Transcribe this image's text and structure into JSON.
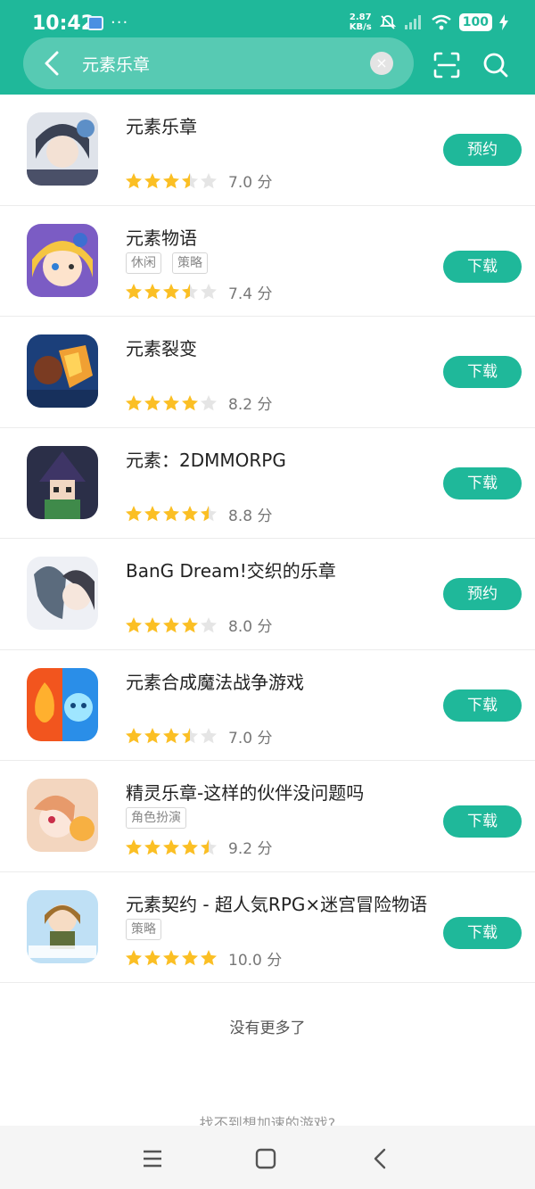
{
  "status": {
    "time": "10:42",
    "dots": "···",
    "net_speed_value": "2.87",
    "net_speed_unit": "KB/s",
    "battery": "100"
  },
  "search": {
    "query": "元素乐章",
    "clear_glyph": "×"
  },
  "results": [
    {
      "name": "元素乐章",
      "tags": [],
      "rating": 3.5,
      "score": "7.0 分",
      "action": "预约",
      "icon": "elemental-chapter-icon"
    },
    {
      "name": "元素物语",
      "tags": [
        "休闲",
        "策略"
      ],
      "rating": 3.5,
      "score": "7.4 分",
      "action": "下载",
      "icon": "elemental-story-icon"
    },
    {
      "name": "元素裂变",
      "tags": [],
      "rating": 4,
      "score": "8.2 分",
      "action": "下载",
      "icon": "elemental-fission-icon"
    },
    {
      "name": "元素：2DMMORPG",
      "tags": [],
      "rating": 4.5,
      "score": "8.8 分",
      "action": "下载",
      "icon": "elemental-mmorpg-icon"
    },
    {
      "name": "BanG Dream!交织的乐章",
      "tags": [],
      "rating": 4,
      "score": "8.0 分",
      "action": "预约",
      "icon": "bang-dream-icon"
    },
    {
      "name": "元素合成魔法战争游戏",
      "tags": [],
      "rating": 3.5,
      "score": "7.0 分",
      "action": "下载",
      "icon": "element-merge-icon"
    },
    {
      "name": "精灵乐章-这样的伙伴没问题吗",
      "tags": [
        "角色扮演"
      ],
      "rating": 4.5,
      "score": "9.2 分",
      "action": "下载",
      "icon": "spirit-chapter-icon"
    },
    {
      "name": "元素契约 - 超人気RPG×迷宫冒险物语",
      "tags": [
        "策略"
      ],
      "rating": 5,
      "score": "10.0 分",
      "action": "下载",
      "icon": "dungeon-fantasy-icon"
    }
  ],
  "footer": {
    "no_more": "没有更多了",
    "cant_find": "找不到想加速的游戏?"
  },
  "colors": {
    "accent": "#1fb89a",
    "star": "#fbbf24",
    "star_empty": "#e5e5e5"
  }
}
